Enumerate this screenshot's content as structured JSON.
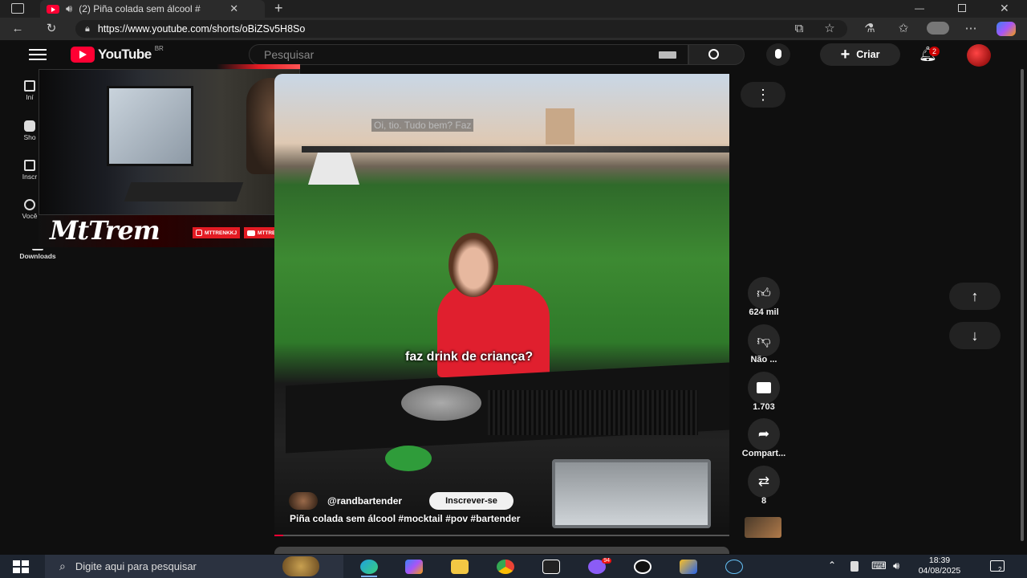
{
  "browser": {
    "tab_title": "(2) Piña colada sem álcool #",
    "url": "https://www.youtube.com/shorts/oBiZSv5H8So"
  },
  "youtube": {
    "logo_text": "YouTube",
    "region": "BR",
    "search_placeholder": "Pesquisar",
    "create_label": "Criar",
    "notifications_count": "2"
  },
  "sidebar": {
    "items": [
      {
        "label": "Iní"
      },
      {
        "label": "Sho"
      },
      {
        "label": "Inscr"
      },
      {
        "label": "Você"
      },
      {
        "label": "Downloads"
      }
    ]
  },
  "overlay": {
    "brand": "MtTrem",
    "tag1": "MTTRENKKJ",
    "tag2": "MTTREM"
  },
  "video": {
    "top_caption": "Oi, tio. Tudo bem? Faz",
    "caption": "faz drink de criança?",
    "channel": "@randbartender",
    "subscribe_label": "Inscrever-se",
    "title": "Piña colada sem álcool #mocktail #pov #bartender",
    "progress": 0.02
  },
  "actions": {
    "likes": "624 mil",
    "dislike_label": "Não ...",
    "comments": "1.703",
    "share_label": "Compart...",
    "remix_count": "8"
  },
  "taskbar": {
    "search_placeholder": "Digite aqui para pesquisar",
    "time": "18:39",
    "date": "04/08/2025",
    "chat_badge": "94",
    "notification_count": "2"
  }
}
